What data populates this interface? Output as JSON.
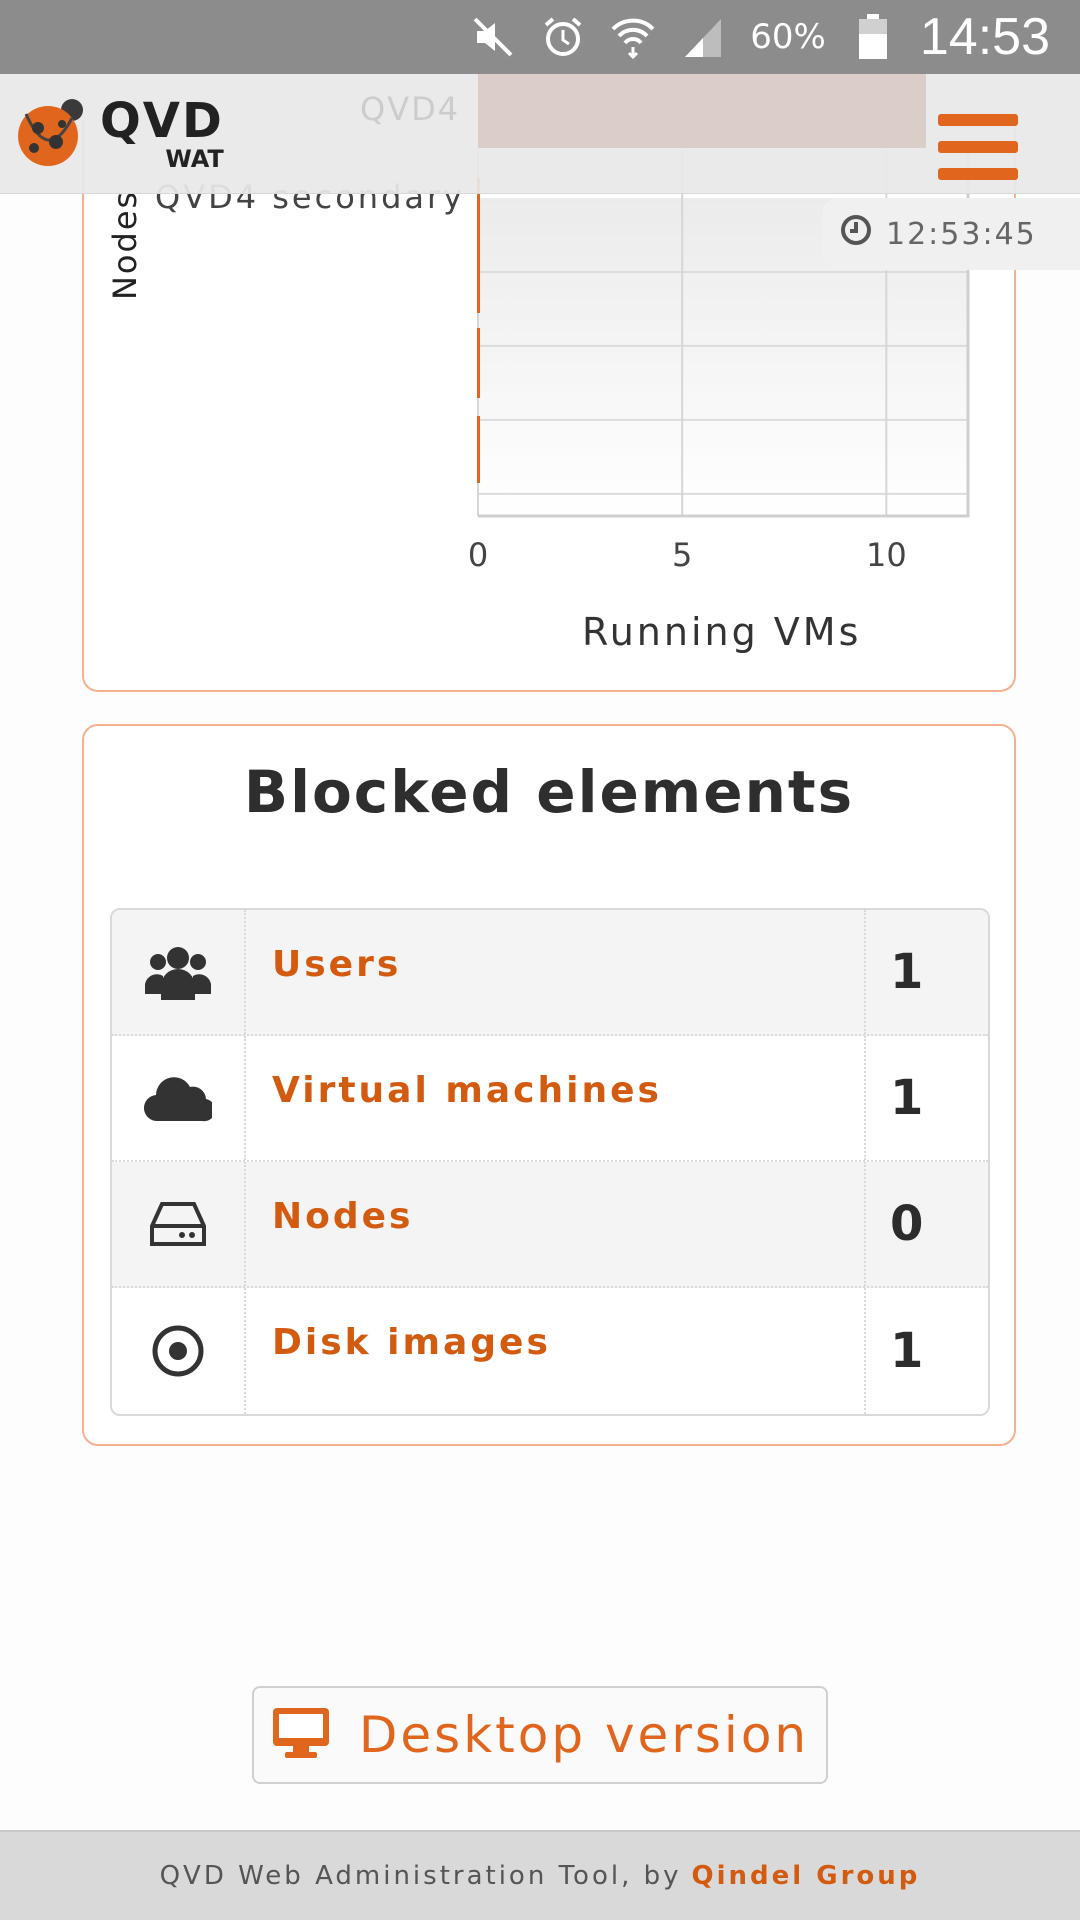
{
  "status_bar": {
    "battery_percent": "60%",
    "time": "14:53",
    "icons": [
      "mute-icon",
      "alarm-icon",
      "wifi-icon",
      "signal-icon",
      "battery-icon"
    ]
  },
  "header": {
    "logo_main": "QVD",
    "logo_sub": "WAT",
    "ghost_label": "QVD4",
    "menu_icon": "hamburger-menu-icon"
  },
  "time_badge": {
    "icon": "clock-icon",
    "time": "12:53:45"
  },
  "chart": {
    "chart_data": {
      "type": "bar",
      "orientation": "horizontal",
      "categories": [
        "QVD4",
        "QVD4 secondary"
      ],
      "values": [
        0,
        0
      ],
      "ylabel": "Nodes",
      "xlabel": "Running VMs",
      "xticks": [
        "0",
        "5",
        "10"
      ],
      "xlim": [
        0,
        12
      ],
      "grid": true,
      "bar_color": "#e0661d"
    }
  },
  "blocked": {
    "title": "Blocked elements",
    "rows": [
      {
        "icon": "users-icon",
        "label": "Users",
        "count": "1"
      },
      {
        "icon": "cloud-icon",
        "label": "Virtual machines",
        "count": "1"
      },
      {
        "icon": "hard-drive-icon",
        "label": "Nodes",
        "count": "0"
      },
      {
        "icon": "disk-image-icon",
        "label": "Disk images",
        "count": "1"
      }
    ]
  },
  "desktop_button": {
    "icon": "desktop-monitor-icon",
    "label": "Desktop version"
  },
  "footer": {
    "text": "QVD Web Administration Tool, by",
    "brand": "Qindel Group"
  },
  "colors": {
    "accent": "#e0661d",
    "link": "#d25b10",
    "panel_border": "#f5b08e"
  }
}
